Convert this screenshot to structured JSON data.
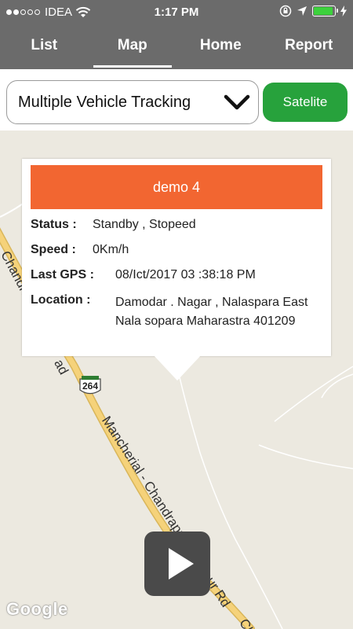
{
  "status_bar": {
    "carrier": "IDEA",
    "time": "1:17 PM",
    "signal_dots_filled": 2,
    "signal_dots_total": 5,
    "battery_level": 0.85
  },
  "tabs": [
    {
      "label": "List",
      "active": false
    },
    {
      "label": "Map",
      "active": true
    },
    {
      "label": "Home",
      "active": false
    },
    {
      "label": "Report",
      "active": false
    }
  ],
  "controls": {
    "tracking_select": "Multiple Vehicle Tracking",
    "satellite_button": "Satelite"
  },
  "popup": {
    "title": "demo 4",
    "status_label": "Status :",
    "status_value": "Standby , Stopeed",
    "speed_label": "Speed :",
    "speed_value": "0Km/h",
    "gps_label": "Last GPS :",
    "gps_value": "08/Ict/2017 03 :38:18 PM",
    "location_label": "Location :",
    "location_line1": "Damodar . Nagar , Nalaspara East",
    "location_line2": "Nala sopara Maharastra 401209"
  },
  "map": {
    "highway_shield": "264",
    "road_label_main": "Mancherial - Chandrapur - Nagpur Rd",
    "road_label_top": "Chandrapur",
    "road_label_small": "ad",
    "road_label_corner": "Ch",
    "attribution": "Google"
  },
  "colors": {
    "header_bg": "#6b6b6b",
    "popup_header": "#f26631",
    "satellite_button": "#27a23c",
    "map_bg": "#ece9e0",
    "road": "#f5d27a"
  }
}
